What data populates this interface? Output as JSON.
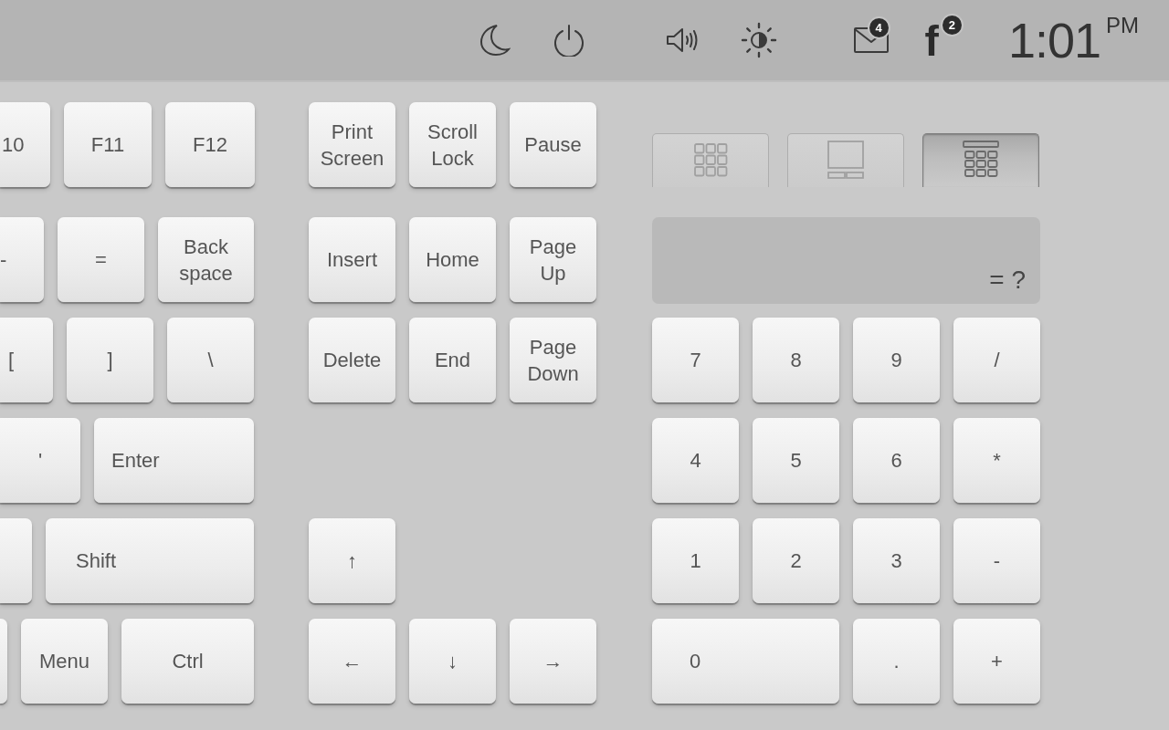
{
  "status_bar": {
    "mail_badge": "4",
    "app_glyph": "f",
    "app_badge": "2",
    "time": "1:01",
    "period": "PM"
  },
  "main_keys": [
    {
      "keys": [
        {
          "kind": "cut",
          "label": "10"
        },
        {
          "kind": "key",
          "label": "F11"
        },
        {
          "kind": "key",
          "label": "F12"
        }
      ]
    },
    {
      "keys": [
        {
          "kind": "cut",
          "label": "-"
        },
        {
          "kind": "key",
          "label": "="
        },
        {
          "kind": "key",
          "label": "Back space"
        }
      ]
    },
    {
      "keys": [
        {
          "kind": "cut",
          "label": "["
        },
        {
          "kind": "key",
          "label": "]"
        },
        {
          "kind": "key",
          "label": "\\"
        }
      ]
    },
    {
      "keys": [
        {
          "kind": "cut",
          "label": "'"
        },
        {
          "kind": "key",
          "label": "Enter"
        }
      ]
    },
    {
      "keys": [
        {
          "kind": "cut"
        },
        {
          "kind": "key",
          "label": "Shift"
        }
      ]
    },
    {
      "keys": [
        {
          "kind": "cut"
        },
        {
          "kind": "key",
          "label": "Menu"
        },
        {
          "kind": "key",
          "label": "Ctrl"
        }
      ]
    }
  ],
  "nav_keys": [
    {
      "label": "Print Screen"
    },
    {
      "label": "Scroll Lock"
    },
    {
      "label": "Pause"
    },
    {
      "label": "Insert"
    },
    {
      "label": "Home"
    },
    {
      "label": "Page Up"
    },
    {
      "label": "Delete"
    },
    {
      "label": "End"
    },
    {
      "label": "Page Down"
    }
  ],
  "arrow_keys": [
    {
      "label": "↑"
    },
    {
      "label": "←"
    },
    {
      "label": "↓"
    },
    {
      "label": "→"
    }
  ],
  "mode_tabs": [
    {
      "kind": "keypad",
      "selected": false
    },
    {
      "kind": "touchpad",
      "selected": false
    },
    {
      "kind": "calculator",
      "selected": true
    }
  ],
  "calculator_display": {
    "text": "= ?"
  },
  "numpad": [
    {
      "kind": "key",
      "label": "7"
    },
    {
      "kind": "key",
      "label": "8"
    },
    {
      "kind": "key",
      "label": "9"
    },
    {
      "kind": "key",
      "label": "/"
    },
    {
      "kind": "key",
      "label": "4"
    },
    {
      "kind": "key",
      "label": "5"
    },
    {
      "kind": "key",
      "label": "6"
    },
    {
      "kind": "key",
      "label": "*"
    },
    {
      "kind": "key",
      "label": "1"
    },
    {
      "kind": "key",
      "label": "2"
    },
    {
      "kind": "key",
      "label": "3"
    },
    {
      "kind": "key",
      "label": "-"
    },
    {
      "kind": "wide",
      "label": "0"
    },
    {
      "kind": "key",
      "label": "."
    },
    {
      "kind": "key",
      "label": "+"
    }
  ]
}
